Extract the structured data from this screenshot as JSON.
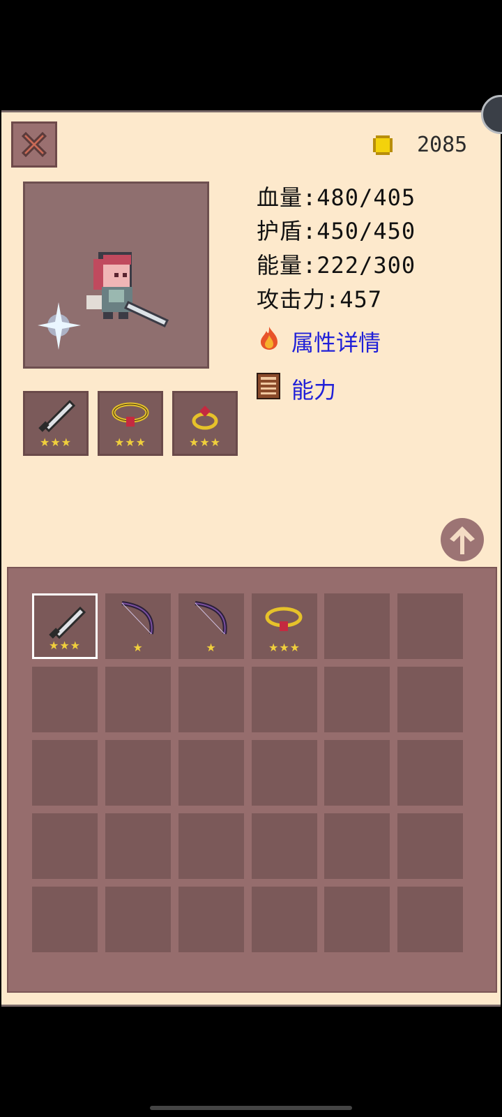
{
  "header": {
    "gold_amount": "2085"
  },
  "stats": {
    "hp": "血量:480/405",
    "shield": "护盾:450/450",
    "energy": "能量:222/300",
    "attack": "攻击力:457"
  },
  "links": {
    "attribute_details": "属性详情",
    "abilities": "能力"
  },
  "equipped": [
    {
      "item": "sword",
      "stars": "★★★"
    },
    {
      "item": "ruby-necklace",
      "stars": "★★★"
    },
    {
      "item": "ruby-ring",
      "stars": "★★★"
    }
  ],
  "inventory": [
    {
      "item": "sword",
      "stars": "★★★",
      "selected": true
    },
    {
      "item": "dark-bow",
      "stars": "★"
    },
    {
      "item": "dark-bow",
      "stars": "★"
    },
    {
      "item": "ruby-necklace",
      "stars": "★★★"
    }
  ],
  "colors": {
    "panel_bg": "#FDE9CC",
    "link": "#2020d8",
    "slot": "#7b5959",
    "inventory_bg": "#966d6d"
  }
}
